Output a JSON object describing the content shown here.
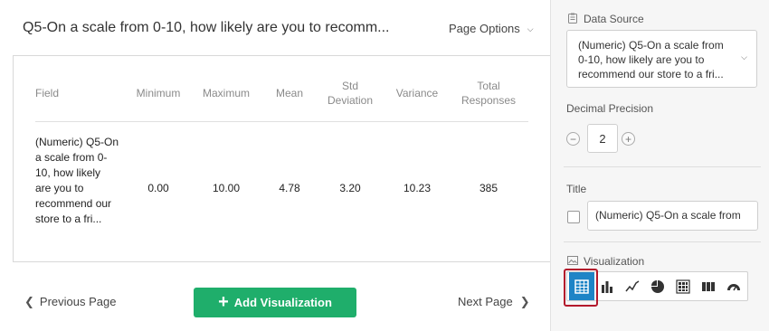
{
  "header": {
    "title": "Q5-On a scale from 0-10, how likely are you to recomm...",
    "page_options_label": "Page Options"
  },
  "table": {
    "columns": [
      "Field",
      "Minimum",
      "Maximum",
      "Mean",
      "Std Deviation",
      "Variance",
      "Total Responses"
    ],
    "column_lines": {
      "std_1": "Std",
      "std_2": "Deviation",
      "total_1": "Total",
      "total_2": "Responses"
    },
    "row": {
      "field": "(Numeric) Q5-On a scale from 0-10, how likely are you to recommend our store to a fri...",
      "minimum": "0.00",
      "maximum": "10.00",
      "mean": "4.78",
      "std_deviation": "3.20",
      "variance": "10.23",
      "total_responses": "385"
    }
  },
  "footer": {
    "previous_page": "Previous Page",
    "add_visualization": "Add Visualization",
    "next_page": "Next Page"
  },
  "sidebar": {
    "data_source_label": "Data Source",
    "data_source_value": "(Numeric) Q5-On a scale from 0-10, how likely are you to recommend our store to a fri...",
    "decimal_precision_label": "Decimal Precision",
    "decimal_precision_value": "2",
    "title_label": "Title",
    "title_value": "(Numeric) Q5-On a scale from",
    "title_checked": false,
    "visualization_label": "Visualization",
    "visualization_types": [
      "table-icon",
      "bar-chart-icon",
      "line-chart-icon",
      "pie-chart-icon",
      "grid-icon",
      "column-chart-icon",
      "gauge-icon"
    ],
    "selected_visualization": "table-icon"
  },
  "colors": {
    "accent_green": "#1fae6b",
    "selected_blue": "#1e84c6",
    "highlight_red": "#b3192c"
  }
}
